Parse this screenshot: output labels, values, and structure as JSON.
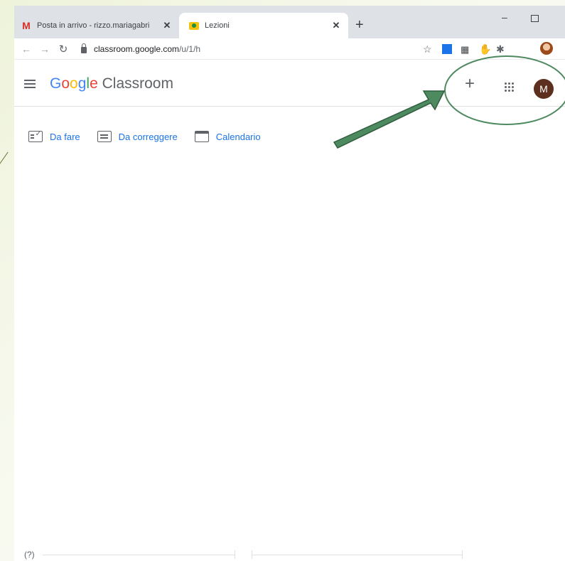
{
  "browser": {
    "tabs": [
      {
        "title": "Posta in arrivo - rizzo.mariagabri",
        "icon": "gmail-icon",
        "active": false
      },
      {
        "title": "Lezioni",
        "icon": "classroom-icon",
        "active": true
      }
    ],
    "close_symbol": "✕",
    "new_tab_symbol": "+",
    "url_host": "classroom.google.com",
    "url_path": "/u/1/h"
  },
  "app": {
    "logo_google": [
      "G",
      "o",
      "o",
      "g",
      "l",
      "e"
    ],
    "logo_product": "Classroom",
    "plus_symbol": "+",
    "account_initial": "M"
  },
  "links": [
    {
      "label": "Da fare",
      "icon": "todo-icon"
    },
    {
      "label": "Da correggere",
      "icon": "review-icon"
    },
    {
      "label": "Calendario",
      "icon": "calendar-icon"
    }
  ],
  "footer": {
    "help_symbol": "(?)"
  },
  "colors": {
    "accent": "#1a73e8",
    "annotation_green": "#4e8a60",
    "avatar": "#5d2f1f"
  }
}
